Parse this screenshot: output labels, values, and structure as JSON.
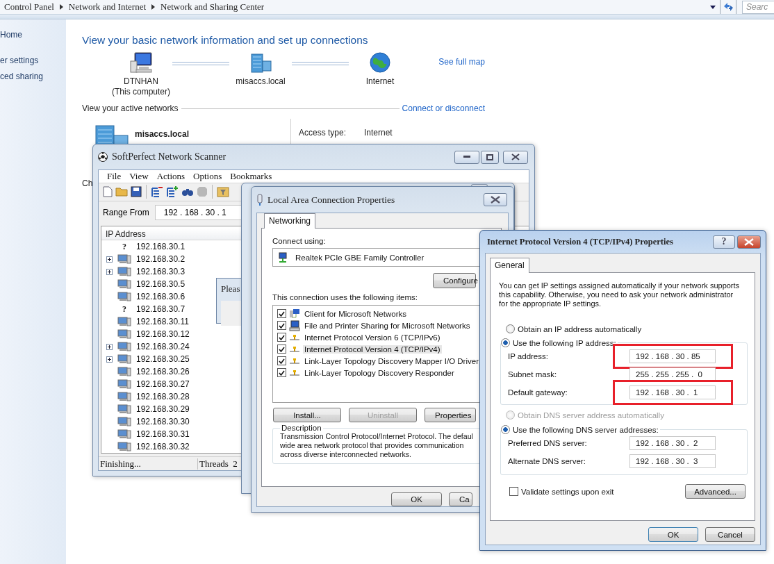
{
  "explorer": {
    "breadcrumb": [
      "Control Panel",
      "Network and Internet",
      "Network and Sharing Center"
    ],
    "search": {
      "placeholder": "Searc"
    },
    "sidebar": {
      "items": [
        "Home",
        "er settings",
        "ced sharing"
      ]
    },
    "heading": "View your basic network information and set up connections",
    "map": {
      "nodes": [
        {
          "kind": "computer",
          "name": "DTNHAN",
          "note": "(This computer)"
        },
        {
          "kind": "network",
          "name": "misaccs.local"
        },
        {
          "kind": "internet",
          "name": "Internet"
        }
      ],
      "link": "See full map"
    },
    "active_networks": {
      "title": "View your active networks",
      "link": "Connect or disconnect",
      "network": {
        "name": "misaccs.local",
        "fields": [
          {
            "label": "Access type:",
            "value": "Internet"
          }
        ]
      }
    },
    "fragment": "Ch"
  },
  "scanner": {
    "title": "SoftPerfect Network Scanner",
    "menu": [
      "File",
      "View",
      "Actions",
      "Options",
      "Bookmarks"
    ],
    "range": {
      "label": "Range From",
      "value": "192 . 168 . 30 . 1"
    },
    "columns": [
      "IP Address"
    ],
    "hosts": [
      {
        "ip": "192.168.30.1",
        "kind": "unknown",
        "mark": "?",
        "expandable": false
      },
      {
        "ip": "192.168.30.2",
        "kind": "computer",
        "expandable": true
      },
      {
        "ip": "192.168.30.3",
        "kind": "computer",
        "expandable": true
      },
      {
        "ip": "192.168.30.5",
        "kind": "computer",
        "expandable": false
      },
      {
        "ip": "192.168.30.6",
        "kind": "computer",
        "expandable": false
      },
      {
        "ip": "192.168.30.7",
        "kind": "unknown",
        "mark": "?",
        "expandable": false
      },
      {
        "ip": "192.168.30.11",
        "kind": "computer",
        "expandable": false
      },
      {
        "ip": "192.168.30.12",
        "kind": "computer",
        "expandable": false
      },
      {
        "ip": "192.168.30.24",
        "kind": "computer",
        "expandable": true
      },
      {
        "ip": "192.168.30.25",
        "kind": "computer",
        "expandable": true
      },
      {
        "ip": "192.168.30.26",
        "kind": "computer",
        "expandable": false
      },
      {
        "ip": "192.168.30.27",
        "kind": "computer",
        "expandable": false
      },
      {
        "ip": "192.168.30.28",
        "kind": "computer",
        "expandable": false
      },
      {
        "ip": "192.168.30.29",
        "kind": "computer",
        "expandable": false
      },
      {
        "ip": "192.168.30.30",
        "kind": "computer",
        "expandable": false
      },
      {
        "ip": "192.168.30.31",
        "kind": "computer",
        "expandable": false
      },
      {
        "ip": "192.168.30.32",
        "kind": "computer",
        "expandable": false
      }
    ],
    "status": {
      "state": "Finishing...",
      "threads": "Threads  2"
    }
  },
  "please_dialog": {
    "title": "Pleas"
  },
  "lan_properties": {
    "title": "Local Area Connection Properties",
    "tabs": [
      {
        "label": "Networking",
        "selected": true
      }
    ],
    "connect_using_label": "Connect using:",
    "adapter": "Realtek PCIe GBE Family Controller",
    "configure_button": "Configure",
    "items_label": "This connection uses the following items:",
    "items": [
      {
        "label": "Client for Microsoft Networks",
        "kind": "client",
        "checked": true,
        "selected": false
      },
      {
        "label": "File and Printer Sharing for Microsoft Networks",
        "kind": "service",
        "checked": true,
        "selected": false
      },
      {
        "label": "Internet Protocol Version 6 (TCP/IPv6)",
        "kind": "protocol",
        "checked": true,
        "selected": false
      },
      {
        "label": "Internet Protocol Version 4 (TCP/IPv4)",
        "kind": "protocol",
        "checked": true,
        "selected": true
      },
      {
        "label": "Link-Layer Topology Discovery Mapper I/O Driver",
        "kind": "protocol",
        "checked": true,
        "selected": false
      },
      {
        "label": "Link-Layer Topology Discovery Responder",
        "kind": "protocol",
        "checked": true,
        "selected": false
      }
    ],
    "buttons": [
      {
        "label": "Install...",
        "disabled": false
      },
      {
        "label": "Uninstall",
        "disabled": true
      },
      {
        "label": "Properties",
        "disabled": false
      }
    ],
    "description": {
      "title": "Description",
      "lines": [
        "Transmission Control Protocol/Internet Protocol. The defaul",
        "wide area network protocol that provides communication",
        "across diverse interconnected networks."
      ]
    },
    "footer_buttons": [
      "OK",
      "Ca"
    ]
  },
  "ipv4_properties": {
    "title": "Internet Protocol Version 4 (TCP/IPv4) Properties",
    "help_button": "?",
    "tabs": [
      {
        "label": "General",
        "selected": true
      }
    ],
    "intro": "You can get IP settings assigned automatically if your network supports this capability. Otherwise, you need to ask your network administrator for the appropriate IP settings.",
    "ip_options": [
      {
        "label": "Obtain an IP address automatically",
        "selected": false,
        "disabled": false
      },
      {
        "label": "Use the following IP address:",
        "selected": true,
        "disabled": false
      }
    ],
    "ip_fields": [
      {
        "label": "IP address:",
        "value": "192 . 168 . 30 . 85",
        "highlighted": true
      },
      {
        "label": "Subnet mask:",
        "value": "255 . 255 . 255 .  0",
        "highlighted": false
      },
      {
        "label": "Default gateway:",
        "value": "192 . 168 . 30 .  1",
        "highlighted": true
      }
    ],
    "dns_options": [
      {
        "label": "Obtain DNS server address automatically",
        "selected": false,
        "disabled": true
      },
      {
        "label": "Use the following DNS server addresses:",
        "selected": true,
        "disabled": false
      }
    ],
    "dns_fields": [
      {
        "label": "Preferred DNS server:",
        "value": "192 . 168 . 30 .  2",
        "highlighted": false
      },
      {
        "label": "Alternate DNS server:",
        "value": "192 . 168 . 30 .  3",
        "highlighted": false
      }
    ],
    "validate": {
      "label": "Validate settings upon exit",
      "checked": false
    },
    "advanced_button": "Advanced...",
    "buttons": [
      "OK",
      "Cancel"
    ]
  }
}
